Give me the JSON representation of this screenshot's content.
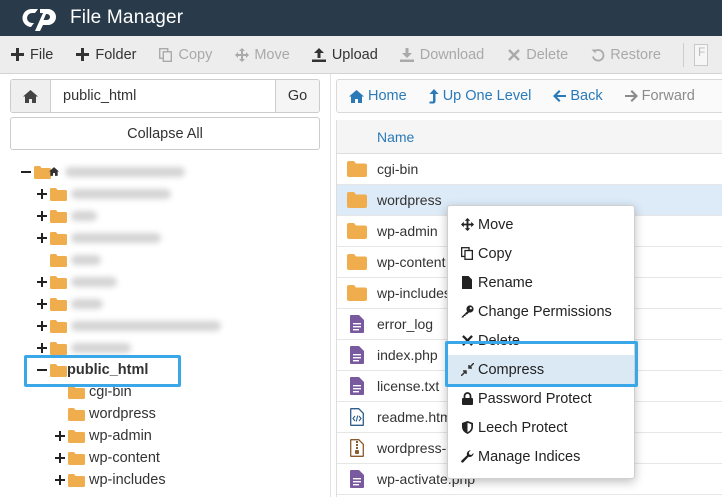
{
  "header": {
    "title": "File Manager"
  },
  "toolbar": {
    "buttons": [
      {
        "label": "File",
        "icon": "plus-icon"
      },
      {
        "label": "Folder",
        "icon": "plus-icon"
      },
      {
        "label": "Copy",
        "icon": "copy-icon"
      },
      {
        "label": "Move",
        "icon": "move-icon"
      },
      {
        "label": "Upload",
        "icon": "upload-icon"
      },
      {
        "label": "Download",
        "icon": "download-icon"
      },
      {
        "label": "Delete",
        "icon": "close-icon"
      },
      {
        "label": "Restore",
        "icon": "restore-icon"
      }
    ]
  },
  "left": {
    "path_value": "public_html",
    "go_label": "Go",
    "collapse_label": "Collapse All"
  },
  "tree": {
    "public_html": "public_html",
    "children": [
      "cgi-bin",
      "wordpress",
      "wp-admin",
      "wp-content",
      "wp-includes"
    ]
  },
  "nav": {
    "home": "Home",
    "up": "Up One Level",
    "back": "Back",
    "forward": "Forward"
  },
  "table": {
    "name_header": "Name",
    "files": [
      {
        "name": "cgi-bin",
        "type": "folder"
      },
      {
        "name": "wordpress",
        "type": "folder"
      },
      {
        "name": "wp-admin",
        "type": "folder"
      },
      {
        "name": "wp-content",
        "type": "folder"
      },
      {
        "name": "wp-includes",
        "type": "folder"
      },
      {
        "name": "error_log",
        "type": "text"
      },
      {
        "name": "index.php",
        "type": "text"
      },
      {
        "name": "license.txt",
        "type": "text"
      },
      {
        "name": "readme.html",
        "type": "html"
      },
      {
        "name": "wordpress-",
        "type": "archive"
      },
      {
        "name": "wp-activate.php",
        "type": "text"
      }
    ]
  },
  "context_menu": {
    "items": [
      {
        "label": "Move",
        "icon": "move-icon"
      },
      {
        "label": "Copy",
        "icon": "copy-icon"
      },
      {
        "label": "Rename",
        "icon": "file-icon"
      },
      {
        "label": "Change Permissions",
        "icon": "key-icon"
      },
      {
        "label": "Delete",
        "icon": "close-icon"
      },
      {
        "label": "Compress",
        "icon": "compress-icon"
      },
      {
        "label": "Password Protect",
        "icon": "lock-icon"
      },
      {
        "label": "Leech Protect",
        "icon": "shield-icon"
      },
      {
        "label": "Manage Indices",
        "icon": "wrench-icon"
      }
    ]
  },
  "colors": {
    "header_bg": "#293a4a",
    "accent": "#2a7ab8",
    "highlight": "#39a7e8",
    "folder": "#f0ad4e"
  }
}
